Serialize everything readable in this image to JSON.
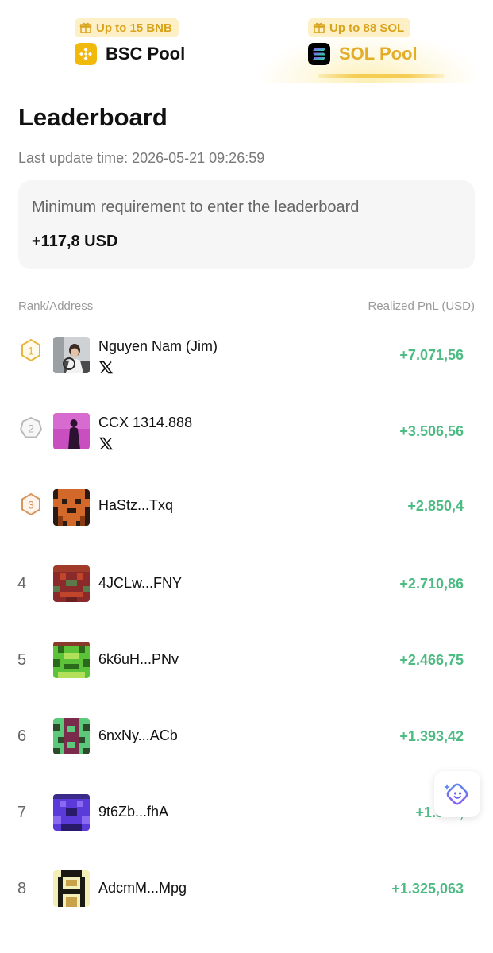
{
  "pools": [
    {
      "id": "bsc",
      "badge": "Up to 15 BNB",
      "name": "BSC Pool",
      "active": false,
      "icon": "bnb-icon"
    },
    {
      "id": "sol",
      "badge": "Up to 88 SOL",
      "name": "SOL Pool",
      "active": true,
      "icon": "solana-icon"
    }
  ],
  "header": {
    "title": "Leaderboard",
    "last_update": "Last update time: 2026-05-21 09:26:59"
  },
  "requirement": {
    "label": "Minimum requirement to enter the leaderboard",
    "value": "+117,8 USD"
  },
  "columns": {
    "left": "Rank/Address",
    "right": "Realized PnL (USD)"
  },
  "rows": [
    {
      "rank": "1",
      "name": "Nguyen Nam (Jim)",
      "pnl": "+7.071,56",
      "x_linked": true
    },
    {
      "rank": "2",
      "name": "CCX 1314.888",
      "pnl": "+3.506,56",
      "x_linked": true
    },
    {
      "rank": "3",
      "name": "HaStz...Txq",
      "pnl": "+2.850,4",
      "x_linked": false
    },
    {
      "rank": "4",
      "name": "4JCLw...FNY",
      "pnl": "+2.710,86",
      "x_linked": false
    },
    {
      "rank": "5",
      "name": "6k6uH...PNv",
      "pnl": "+2.466,75",
      "x_linked": false
    },
    {
      "rank": "6",
      "name": "6nxNy...ACb",
      "pnl": "+1.393,42",
      "x_linked": false
    },
    {
      "rank": "7",
      "name": "9t6Zb...fhA",
      "pnl": "+1.360,",
      "x_linked": false
    },
    {
      "rank": "8",
      "name": "AdcmM...Mpg",
      "pnl": "+1.325,063",
      "x_linked": false
    }
  ],
  "colors": {
    "accent_gold": "#e3ad2a",
    "badge_bg": "#fdf0c7",
    "pnl_green": "#4dbb83",
    "rank1": "#e9b43a",
    "rank2": "#b9b9b9",
    "rank3": "#d9955a"
  }
}
